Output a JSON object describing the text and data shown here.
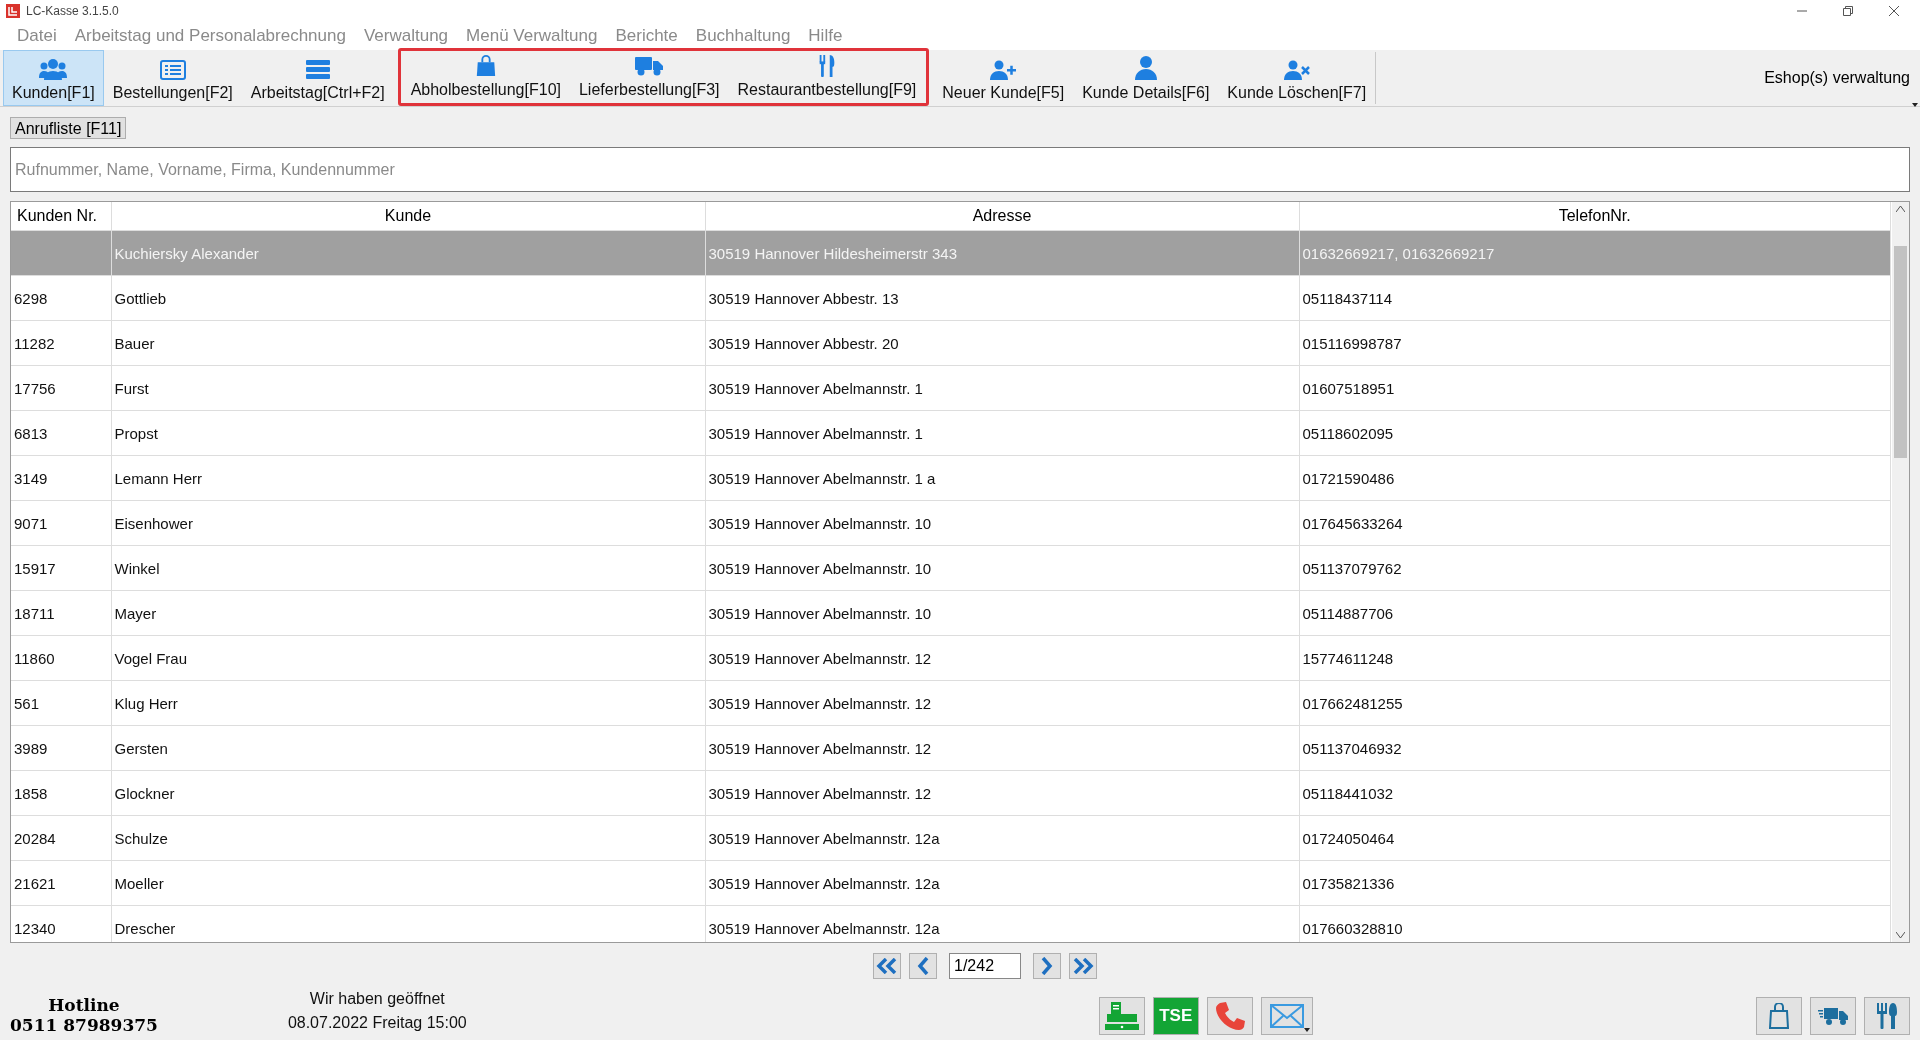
{
  "window": {
    "title": "LC-Kasse 3.1.5.0"
  },
  "menu": [
    "Datei",
    "Arbeitstag und Personalabrechnung",
    "Verwaltung",
    "Menü Verwaltung",
    "Berichte",
    "Buchhaltung",
    "Hilfe"
  ],
  "toolbar": [
    {
      "marked": false,
      "buttons": [
        {
          "label": "Kunden[F1]",
          "selected": true
        },
        {
          "label": "Bestellungen[F2]",
          "selected": false
        },
        {
          "label": "Arbeitstag[Ctrl+F2]",
          "selected": false
        }
      ]
    },
    {
      "marked": true,
      "buttons": [
        {
          "label": "Abholbestellung[F10]",
          "selected": false
        },
        {
          "label": "Lieferbestellung[F3]",
          "selected": false
        },
        {
          "label": "Restaurantbestellung[F9]",
          "selected": false
        }
      ]
    },
    {
      "marked": false,
      "buttons": [
        {
          "label": "Neuer Kunde[F5]",
          "selected": false
        },
        {
          "label": "Kunde Details[F6]",
          "selected": false
        },
        {
          "label": "Kunde Löschen[F7]",
          "selected": false
        }
      ]
    }
  ],
  "eshop_menu": "Eshop(s) verwaltung",
  "call_list_button": "Anrufliste [F11]",
  "search": {
    "placeholder": "Rufnummer, Name, Vorname, Firma, Kundennummer"
  },
  "table": {
    "columns": [
      "Kunden Nr.",
      "Kunde",
      "Adresse",
      "TelefonNr."
    ],
    "rows": [
      {
        "kunde": "Kuchiersky  Alexander",
        "adresse": "30519 Hannover Hildesheimerstr 343",
        "telefon": "01632669217, 01632669217",
        "selected": true
      },
      {
        "nr": "6298",
        "kunde": "Gottlieb",
        "adresse": "30519 Hannover Abbestr. 13",
        "telefon": "05118437114",
        "selected": false
      },
      {
        "nr": "11282",
        "kunde": "Bauer",
        "adresse": "30519 Hannover Abbestr. 20",
        "telefon": "015116998787",
        "selected": false
      },
      {
        "nr": "17756",
        "kunde": "Furst",
        "adresse": "30519 Hannover Abelmannstr. 1",
        "telefon": "01607518951",
        "selected": false
      },
      {
        "nr": "6813",
        "kunde": "Propst",
        "adresse": "30519 Hannover Abelmannstr. 1",
        "telefon": "05118602095",
        "selected": false
      },
      {
        "nr": "3149",
        "kunde": "Lemann Herr",
        "adresse": "30519 Hannover Abelmannstr. 1 a",
        "telefon": "01721590486",
        "selected": false
      },
      {
        "nr": "9071",
        "kunde": "Eisenhower",
        "adresse": "30519 Hannover Abelmannstr. 10",
        "telefon": "017645633264",
        "selected": false
      },
      {
        "nr": "15917",
        "kunde": "Winkel",
        "adresse": "30519 Hannover Abelmannstr. 10",
        "telefon": "051137079762",
        "selected": false
      },
      {
        "nr": "18711",
        "kunde": "Mayer",
        "adresse": "30519 Hannover Abelmannstr. 10",
        "telefon": "05114887706",
        "selected": false
      },
      {
        "nr": "11860",
        "kunde": "Vogel Frau",
        "adresse": "30519 Hannover Abelmannstr. 12",
        "telefon": "15774611248",
        "selected": false
      },
      {
        "nr": "561",
        "kunde": "Klug Herr",
        "adresse": "30519 Hannover Abelmannstr. 12",
        "telefon": "017662481255",
        "selected": false
      },
      {
        "nr": "3989",
        "kunde": "Gersten",
        "adresse": "30519 Hannover Abelmannstr. 12",
        "telefon": "051137046932",
        "selected": false
      },
      {
        "nr": "1858",
        "kunde": "Glockner",
        "adresse": "30519 Hannover Abelmannstr. 12",
        "telefon": "05118441032",
        "selected": false
      },
      {
        "nr": "20284",
        "kunde": "Schulze",
        "adresse": "30519 Hannover Abelmannstr. 12a",
        "telefon": "01724050464",
        "selected": false
      },
      {
        "nr": "21621",
        "kunde": "Moeller",
        "adresse": "30519 Hannover Abelmannstr. 12a",
        "telefon": "01735821336",
        "selected": false
      },
      {
        "nr": "12340",
        "kunde": "Drescher",
        "adresse": "30519 Hannover Abelmannstr. 12a",
        "telefon": "017660328810",
        "selected": false
      }
    ]
  },
  "pager": {
    "page": "1/242"
  },
  "hotline": {
    "label": "Hotline",
    "number": "0511 87989375"
  },
  "status": {
    "open_text": "Wir haben geöffnet",
    "datetime": "08.07.2022 Freitag 15:00"
  },
  "tse_button": "TSE"
}
